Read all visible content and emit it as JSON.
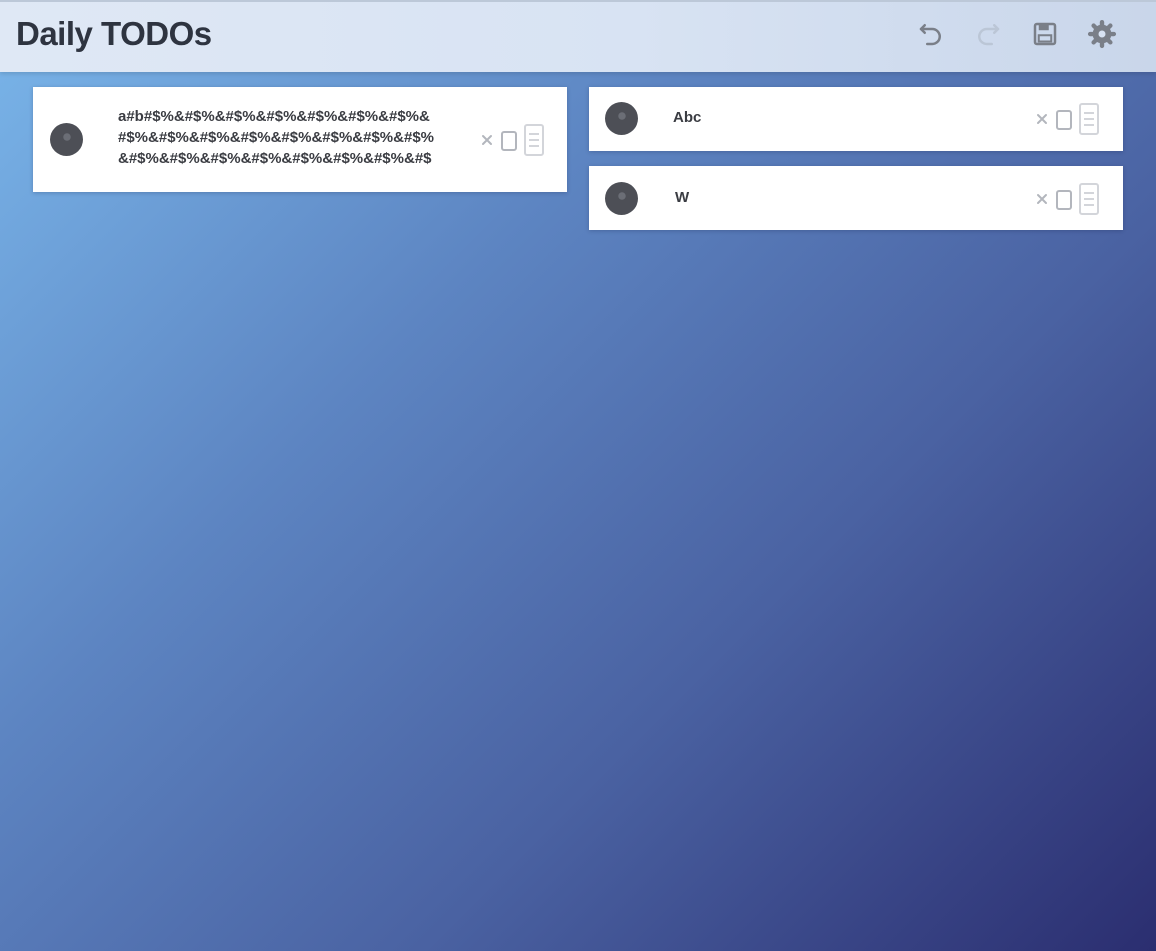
{
  "header": {
    "title": "Daily TODOs"
  },
  "toolbar": {
    "undo_icon": "undo-icon",
    "redo_icon": "redo-icon",
    "save_icon": "save-icon",
    "settings_icon": "gear-icon"
  },
  "todos": [
    {
      "text": "a#b#$%&#$%&#$%&#$%&#$%&#$%&#$%&#$%&#$%&#$%&#$%&#$%&#$%&#$%&#$%&#$%&#$%&#$%&#$%&#$%&#$%&#$%&#$%&#$%&#$%&#$%&#$%&",
      "done": false
    },
    {
      "text": "Abc",
      "done": false
    },
    {
      "text": "W",
      "done": false
    }
  ],
  "colors": {
    "background_start": "#7ab6ea",
    "background_end": "#2b2e70",
    "header_bg": "#dfe8f5",
    "checkbox": "#4d4f56"
  }
}
